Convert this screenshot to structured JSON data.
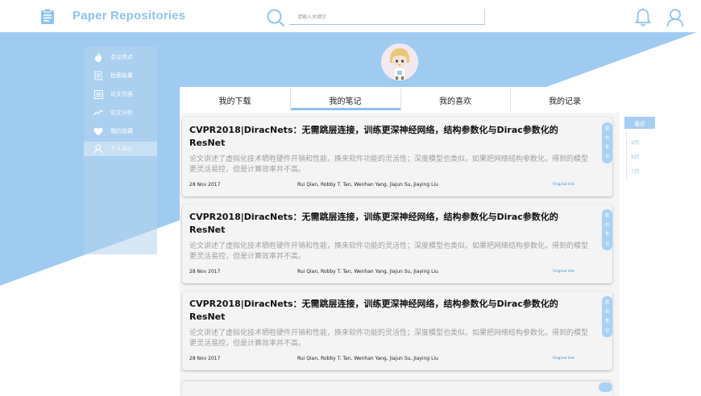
{
  "header": {
    "app_title": "Paper Repositories",
    "search_placeholder": "请输入关键字",
    "icons": [
      "document-icon",
      "search-icon",
      "bell-icon",
      "user-icon"
    ]
  },
  "sidebar": {
    "items": [
      {
        "label": "会议热点",
        "icon": "fire-icon"
      },
      {
        "label": "检索结果",
        "icon": "document-icon"
      },
      {
        "label": "论文列表",
        "icon": "list-icon"
      },
      {
        "label": "论文分析",
        "icon": "chart-icon"
      },
      {
        "label": "我的收藏",
        "icon": "heart-icon"
      },
      {
        "label": "个人中心",
        "icon": "user-icon",
        "active": true
      }
    ]
  },
  "tabs": {
    "items": [
      {
        "label": "我的下载"
      },
      {
        "label": "我的笔记",
        "active": true
      },
      {
        "label": "我的喜欢"
      },
      {
        "label": "我的记录"
      }
    ]
  },
  "cards": [
    {
      "title": "CVPR2018|DiracNets：无需跳层连接，训练更深神经网络，结构参数化与Dirac参数化的ResNet",
      "abstract": "论文讲述了虚拟化技术牺牲硬件开销和性能，换来软件功能的灵活性；深度模型也类似，如果把网络结构参数化，得到的模型更灵活易控，但是计算效率并不高。",
      "date": "28 Nov 2017",
      "authors": "Rui Qian, Robby T. Tan, Wenhan Yang, Jiajun Su, Jiaying Liu",
      "link": "Original link",
      "tag_chars": [
        "图",
        "的",
        "笔",
        "记"
      ]
    },
    {
      "title": "CVPR2018|DiracNets：无需跳层连接，训练更深神经网络，结构参数化与Dirac参数化的ResNet",
      "abstract": "论文讲述了虚拟化技术牺牲硬件开销和性能，换来软件功能的灵活性；深度模型也类似，如果把网络结构参数化，得到的模型更灵活易控，但是计算效率并不高。",
      "date": "28 Nov 2017",
      "authors": "Rui Qian, Robby T. Tan, Wenhan Yang, Jiajun Su, Jiaying Liu",
      "link": "Original link",
      "tag_chars": [
        "图",
        "的",
        "笔",
        "记"
      ]
    },
    {
      "title": "CVPR2018|DiracNets：无需跳层连接，训练更深神经网络，结构参数化与Dirac参数化的ResNet",
      "abstract": "论文讲述了虚拟化技术牺牲硬件开销和性能，换来软件功能的灵活性；深度模型也类似，如果把网络结构参数化，得到的模型更灵活易控，但是计算效率并不高。",
      "date": "28 Nov 2017",
      "authors": "Rui Qian, Robby T. Tan, Wenhan Yang, Jiajun Su, Jiaying Liu",
      "link": "Original link",
      "tag_chars": [
        "图",
        "的",
        "笔",
        "记"
      ]
    }
  ],
  "timeline": {
    "head": "最近",
    "items": [
      "9月",
      "8月",
      "7月"
    ]
  },
  "colors": {
    "brand": "#8fc3ea",
    "panel_blue": "#9fcbf0",
    "tag_blue": "#a8d2f5"
  }
}
